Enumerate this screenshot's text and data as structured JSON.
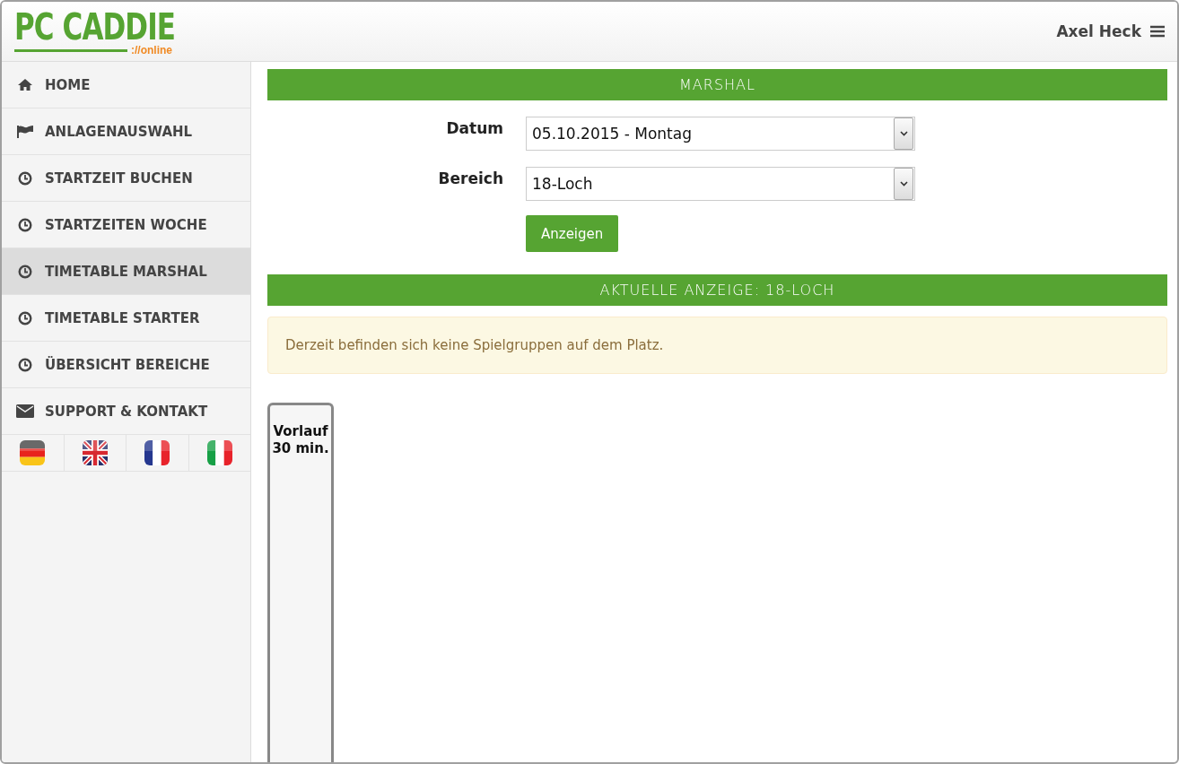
{
  "header": {
    "logo": "PC CADDIE",
    "logo_sub": "://online",
    "user": "Axel Heck"
  },
  "sidebar": {
    "items": [
      {
        "label": "HOME",
        "kind": "home",
        "selected": false
      },
      {
        "label": "ANLAGENAUSWAHL",
        "kind": "venue",
        "selected": false
      },
      {
        "label": "STARTZEIT BUCHEN",
        "kind": "time",
        "selected": false
      },
      {
        "label": "STARTZEITEN WOCHE",
        "kind": "time",
        "selected": false
      },
      {
        "label": "TIMETABLE MARSHAL",
        "kind": "time",
        "selected": true
      },
      {
        "label": "TIMETABLE STARTER",
        "kind": "time",
        "selected": false
      },
      {
        "label": "ÜBERSICHT BEREICHE",
        "kind": "time",
        "selected": false
      },
      {
        "label": "SUPPORT & KONTAKT",
        "kind": "contact",
        "selected": false
      }
    ],
    "languages": [
      {
        "kind": "de"
      },
      {
        "kind": "gb"
      },
      {
        "kind": "fr"
      },
      {
        "kind": "it"
      }
    ]
  },
  "main": {
    "title": "MARSHAL",
    "fields": [
      {
        "label": "Datum",
        "value": "05.10.2015 - Montag"
      },
      {
        "label": "Bereich",
        "value": "18-Loch"
      }
    ],
    "button": "Anzeigen",
    "current_title": "AKTUELLE ANZEIGE: 18-LOCH",
    "alert": "Derzeit befinden sich keine Spielgruppen auf dem Platz.",
    "timeline_column": [
      "Vorlauf",
      "30 min."
    ]
  }
}
